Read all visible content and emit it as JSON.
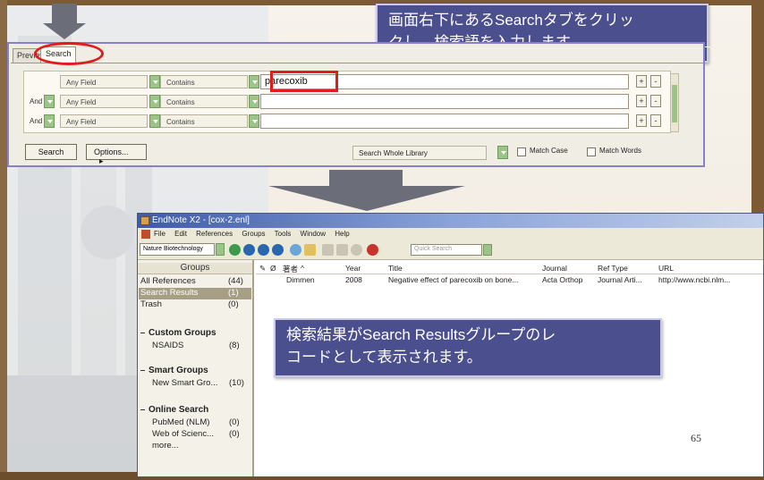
{
  "callout_top": {
    "line1": "画面右下にあるSearchタブをクリッ",
    "line2": "クし、検索語を入力します。"
  },
  "search_panel": {
    "tabs": [
      "Preview",
      "Search"
    ],
    "rows": [
      {
        "bool": "",
        "field": "Any Field",
        "op": "Contains",
        "value": "parecoxib"
      },
      {
        "bool": "And",
        "field": "Any Field",
        "op": "Contains",
        "value": ""
      },
      {
        "bool": "And",
        "field": "Any Field",
        "op": "Contains",
        "value": ""
      }
    ],
    "plus": "+",
    "minus": "-",
    "search_button": "Search",
    "options_button": "Options...",
    "options_arrow": "▸",
    "scope": "Search Whole Library",
    "match_case": "Match Case",
    "match_words": "Match Words"
  },
  "app": {
    "title": "EndNote X2 - [cox-2.enl]",
    "menu": [
      "File",
      "Edit",
      "References",
      "Groups",
      "Tools",
      "Window",
      "Help"
    ],
    "style": "Nature Biotechnology",
    "quick_search": "Quick Search",
    "groups_header": "Groups",
    "groups": {
      "all_refs": {
        "label": "All References",
        "count": "(44)"
      },
      "search_results": {
        "label": "Search Results",
        "count": "(1)"
      },
      "trash": {
        "label": "Trash",
        "count": "(0)"
      },
      "custom": {
        "label": "Custom Groups",
        "items": [
          {
            "label": "NSAIDS",
            "count": "(8)"
          }
        ]
      },
      "smart": {
        "label": "Smart Groups",
        "items": [
          {
            "label": "New Smart Gro...",
            "count": "(10)"
          }
        ]
      },
      "online": {
        "label": "Online Search",
        "items": [
          {
            "label": "PubMed (NLM)",
            "count": "(0)"
          },
          {
            "label": "Web of Scienc...",
            "count": "(0)"
          },
          {
            "label": "more...",
            "count": ""
          }
        ]
      }
    },
    "columns": {
      "author": "著者",
      "year": "Year",
      "title": "Title",
      "journal": "Journal",
      "ref_type": "Ref Type",
      "url": "URL"
    },
    "refs": [
      {
        "author": "Dimmen",
        "year": "2008",
        "title": "Negative effect of parecoxib on bone...",
        "journal": "Acta Orthop",
        "ref_type": "Journal Arti...",
        "url": "http://www.ncbi.nlm..."
      }
    ]
  },
  "callout_bottom": {
    "line1": "検索結果がSearch Resultsグループのレ",
    "line2": "コードとして表示されます。"
  },
  "page_number": "65",
  "colors": {
    "callout_bg": "#4c4f8e",
    "highlight": "#e21b1b",
    "selection": "#a69f86",
    "frame": "#7b5a34"
  }
}
